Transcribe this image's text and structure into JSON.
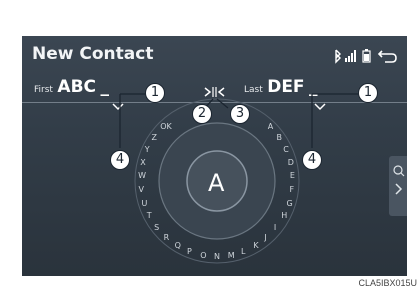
{
  "screen": {
    "title": "New Contact",
    "first": {
      "label": "First",
      "value": "ABC"
    },
    "last": {
      "label": "Last",
      "value": "DEF"
    },
    "wheel": {
      "current_letter": "A",
      "letters": [
        "A",
        "B",
        "C",
        "D",
        "E",
        "F",
        "G",
        "H",
        "I",
        "J",
        "K",
        "L",
        "M",
        "N",
        "O",
        "P",
        "Q",
        "R",
        "S",
        "T",
        "U",
        "V",
        "W",
        "X",
        "Y",
        "Z",
        "OK"
      ]
    },
    "icons": [
      "bluetooth-icon",
      "signal-icon",
      "battery-icon",
      "back-icon",
      "chevron-down-icon",
      "cursor-left-icon",
      "cursor-right-icon",
      "search-icon",
      "chevron-right-icon"
    ]
  },
  "callouts": [
    "1",
    "2",
    "3",
    "4"
  ],
  "figure_code": "CLA5IBX015U",
  "colors": {
    "background": "#323d48",
    "callout_border": "#1b2530"
  }
}
